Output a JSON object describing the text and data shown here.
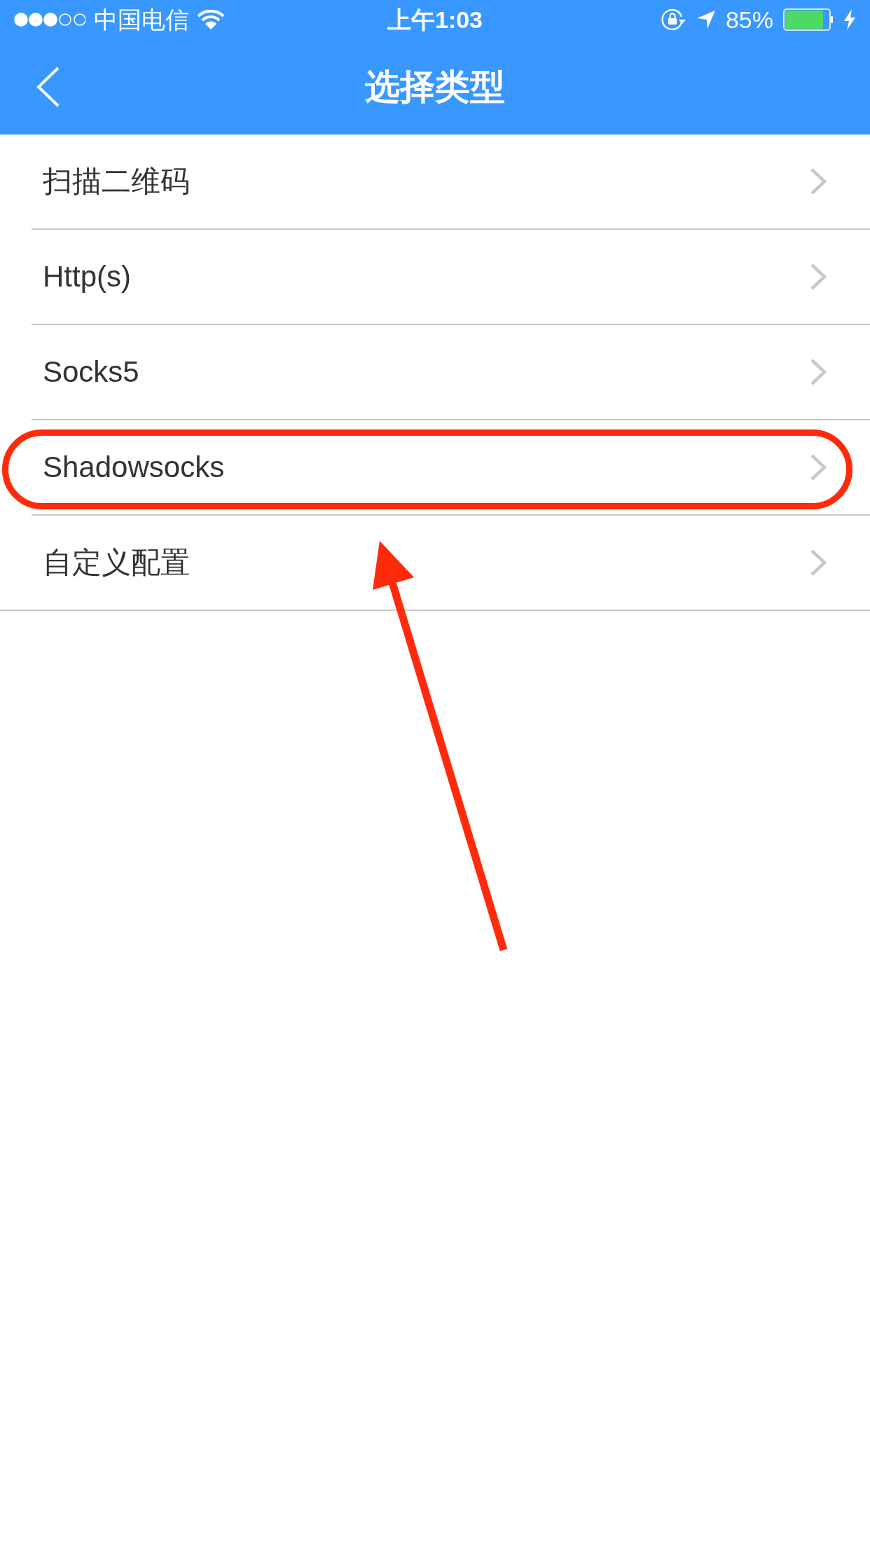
{
  "status_bar": {
    "carrier": "中国电信",
    "time": "上午1:03",
    "battery": "85%"
  },
  "nav_bar": {
    "title": "选择类型"
  },
  "items": [
    {
      "label": "扫描二维码",
      "highlighted": false
    },
    {
      "label": "Http(s)",
      "highlighted": false
    },
    {
      "label": "Socks5",
      "highlighted": false
    },
    {
      "label": "Shadowsocks",
      "highlighted": true
    },
    {
      "label": "自定义配置",
      "highlighted": false
    }
  ]
}
